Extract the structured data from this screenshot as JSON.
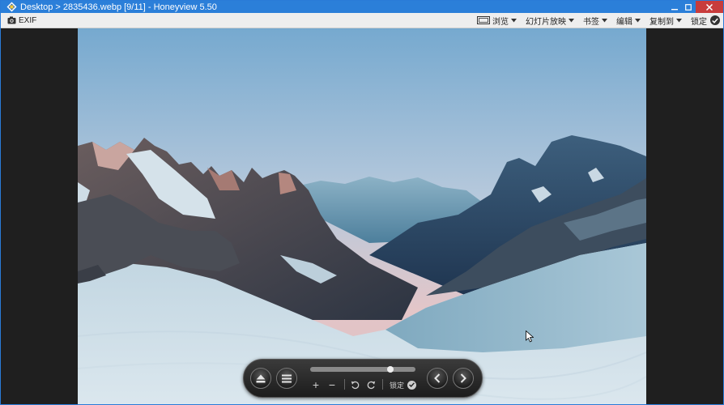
{
  "titlebar": {
    "title": "Desktop > 2835436.webp [9/11] - Honeyview 5.50",
    "icon": "honeyview-app-icon"
  },
  "toolbar": {
    "exif_label": "EXIF",
    "menus": [
      {
        "label": "浏览",
        "icon": "film-frame-icon"
      },
      {
        "label": "幻灯片放映",
        "icon": "chevron-down-icon"
      },
      {
        "label": "书签",
        "icon": "chevron-down-icon"
      },
      {
        "label": "编辑",
        "icon": "chevron-down-icon"
      },
      {
        "label": "复制到",
        "icon": "chevron-down-icon"
      },
      {
        "label": "锁定",
        "icon": "check-circle-icon"
      }
    ]
  },
  "controls": {
    "lock_label": "锁定",
    "zoom_in": "+",
    "zoom_out": "−",
    "slider_fraction": 0.78
  },
  "colors": {
    "titlebar": "#2b7fd9",
    "toolbar": "#eeeeee",
    "viewer_bg": "#1f1f1f"
  }
}
